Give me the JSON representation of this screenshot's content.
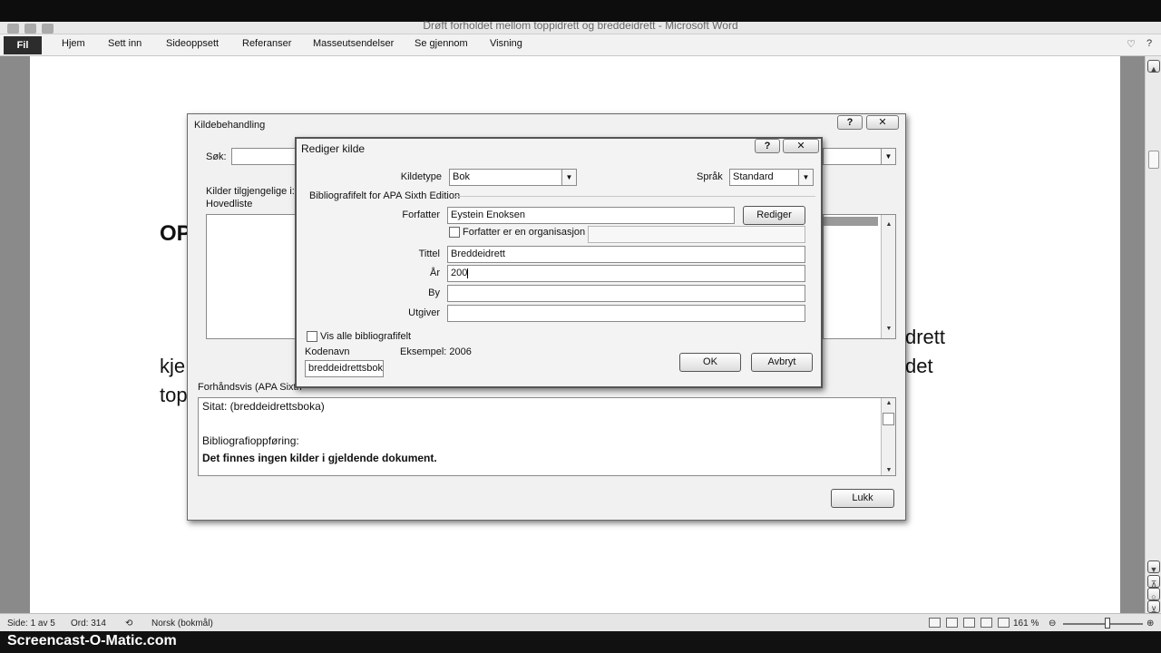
{
  "window": {
    "title": "Drøft forholdet mellom toppidrett og breddeidrett - Microsoft Word"
  },
  "ribbon": {
    "file_tab": "Fil",
    "tabs": [
      "Hjem",
      "Sett inn",
      "Sideoppsett",
      "Referanser",
      "Masseutsendelser",
      "Se gjennom",
      "Visning"
    ]
  },
  "document": {
    "text_fragments": [
      "OP",
      "kje",
      "top",
      "drett",
      "det"
    ]
  },
  "kildebehandling": {
    "title": "Kildebehandling",
    "help": "?",
    "close": "✕",
    "search_label": "Søk:",
    "available_label": "Kilder tilgjengelige i:",
    "master_list": "Hovedliste",
    "preview_label": "Forhåndsvis (APA Sixth",
    "preview_lines": [
      "Sitat:  (breddeidrettsboka)",
      "",
      "Bibliografioppføring:",
      "Det finnes ingen kilder i gjeldende dokument."
    ],
    "close_button": "Lukk"
  },
  "rediger_kilde": {
    "title": "Rediger kilde",
    "help": "?",
    "close": "✕",
    "source_type_label": "Kildetype",
    "source_type_value": "Bok",
    "language_label": "Språk",
    "language_value": "Standard",
    "group_label": "Bibliografifelt for APA Sixth Edition",
    "author_label": "Forfatter",
    "author_value": "Eystein Enoksen",
    "edit_button": "Rediger",
    "corporate_author_label": "Forfatter er en organisasjon",
    "corporate_author_value": "",
    "title_label": "Tittel",
    "title_value": "Breddeidrett",
    "year_label": "År",
    "year_value": "200",
    "city_label": "By",
    "city_value": "",
    "publisher_label": "Utgiver",
    "publisher_value": "",
    "show_all_label": "Vis alle bibliografifelt",
    "tag_name_label": "Kodenavn",
    "example_text": "Eksempel: 2006",
    "tag_name_value": "breddeidrettsboka",
    "ok_button": "OK",
    "cancel_button": "Avbryt"
  },
  "statusbar": {
    "page": "Side: 1 av 5",
    "words": "Ord: 314",
    "language": "Norsk (bokmål)",
    "zoom": "161 %"
  },
  "watermark": "Screencast-O-Matic.com"
}
